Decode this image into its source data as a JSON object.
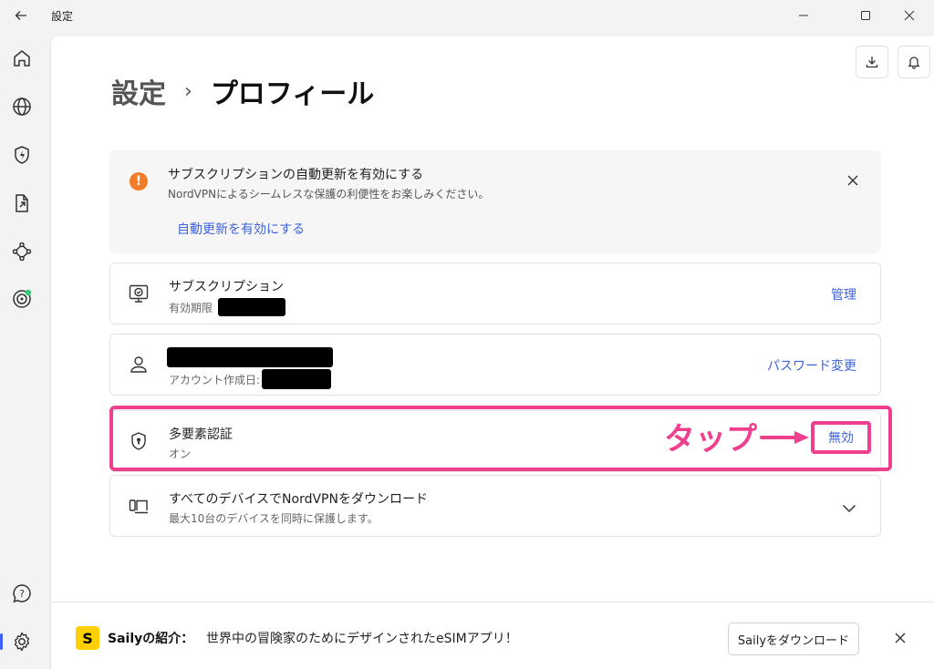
{
  "window": {
    "title": "設定"
  },
  "breadcrumb": {
    "parent": "設定",
    "separator": "›",
    "current": "プロフィール"
  },
  "banner": {
    "title": "サブスクリプションの自動更新を有効にする",
    "description": "NordVPNによるシームレスな保護の利便性をお楽しみください。",
    "link": "自動更新を有効にする",
    "icon": "alert-icon"
  },
  "cards": {
    "subscription": {
      "title": "サブスクリプション",
      "sub_label": "有効期限",
      "action": "管理",
      "icon": "subscription-monitor-icon"
    },
    "account": {
      "sub_label": "アカウント作成日:",
      "action": "パスワード変更",
      "icon": "user-icon"
    },
    "mfa": {
      "title": "多要素認証",
      "status": "オン",
      "action": "無効",
      "icon": "shield-lock-icon"
    },
    "devices": {
      "title": "すべてのデバイスでNordVPNをダウンロード",
      "description": "最大10台のデバイスを同時に保護します。",
      "icon": "devices-icon"
    }
  },
  "annotation": {
    "label": "タップ"
  },
  "footer": {
    "logo": "S",
    "label": "Sailyの紹介：",
    "text": "世界中の冒険家のためにデザインされたeSIMアプリ！",
    "button": "Sailyをダウンロード"
  },
  "colors": {
    "accent": "#3d63dd",
    "highlight": "#ef3f8e",
    "warning": "#f37c2a",
    "saily": "#ffd000",
    "status_dot": "#2ecc71"
  }
}
